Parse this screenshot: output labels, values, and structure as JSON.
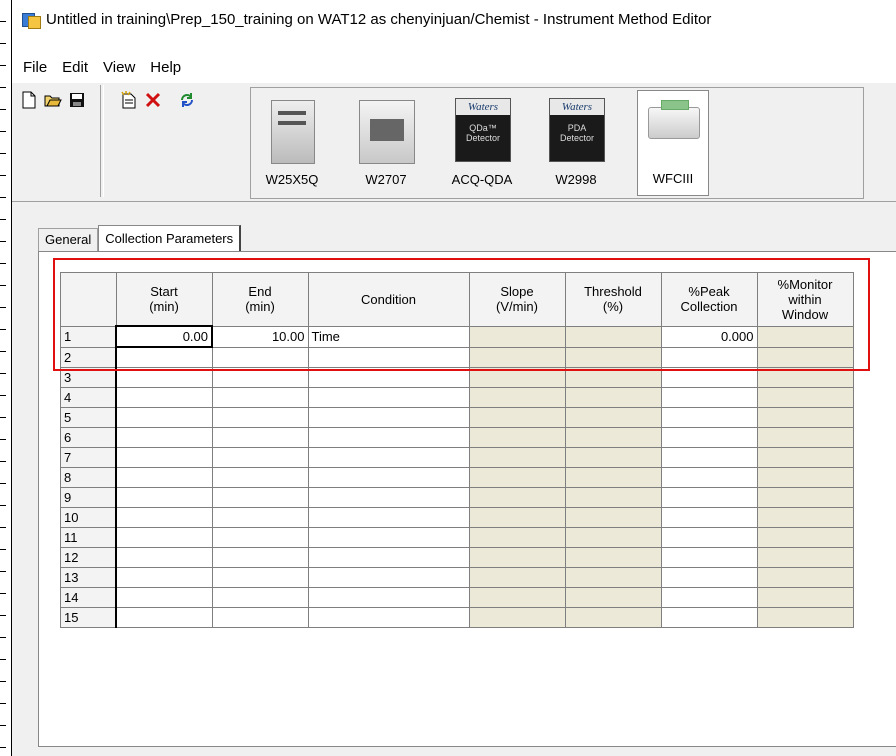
{
  "window": {
    "title": "Untitled in training\\Prep_150_training on WAT12 as chenyinjuan/Chemist - Instrument Method Editor"
  },
  "menu": [
    "File",
    "Edit",
    "View",
    "Help"
  ],
  "toolbar": {
    "buttons": [
      "new-file-icon",
      "open-folder-icon",
      "save-icon",
      "new-document-icon",
      "delete-icon",
      "refresh-icon"
    ]
  },
  "instruments": [
    {
      "label": "W25X5Q",
      "icon": "sample-manager-icon"
    },
    {
      "label": "W2707",
      "icon": "autosampler-icon"
    },
    {
      "label": "ACQ-QDA",
      "icon": "qda-detector-icon",
      "brand": "Waters",
      "text": "QDa™ Detector"
    },
    {
      "label": "W2998",
      "icon": "pda-detector-icon",
      "brand": "Waters",
      "text": "PDA Detector"
    },
    {
      "label": "WFCIII",
      "icon": "fraction-collector-icon",
      "selected": true
    }
  ],
  "tabs": [
    "General",
    "Collection Parameters"
  ],
  "active_tab": "Collection Parameters",
  "grid": {
    "headers": [
      "",
      "Start\n(min)",
      "End\n(min)",
      "Condition",
      "Slope\n(V/min)",
      "Threshold\n(%)",
      "%Peak\nCollection",
      "%Monitor\nwithin\nWindow"
    ],
    "rows": [
      {
        "n": "1",
        "start": "0.00",
        "end": "10.00",
        "condition": "Time",
        "slope": "",
        "threshold": "",
        "peak": "0.000",
        "monitor": ""
      },
      {
        "n": "2",
        "start": "",
        "end": "",
        "condition": "",
        "slope": "",
        "threshold": "",
        "peak": "",
        "monitor": ""
      },
      {
        "n": "3",
        "start": "",
        "end": "",
        "condition": "",
        "slope": "",
        "threshold": "",
        "peak": "",
        "monitor": ""
      },
      {
        "n": "4",
        "start": "",
        "end": "",
        "condition": "",
        "slope": "",
        "threshold": "",
        "peak": "",
        "monitor": ""
      },
      {
        "n": "5",
        "start": "",
        "end": "",
        "condition": "",
        "slope": "",
        "threshold": "",
        "peak": "",
        "monitor": ""
      },
      {
        "n": "6",
        "start": "",
        "end": "",
        "condition": "",
        "slope": "",
        "threshold": "",
        "peak": "",
        "monitor": ""
      },
      {
        "n": "7",
        "start": "",
        "end": "",
        "condition": "",
        "slope": "",
        "threshold": "",
        "peak": "",
        "monitor": ""
      },
      {
        "n": "8",
        "start": "",
        "end": "",
        "condition": "",
        "slope": "",
        "threshold": "",
        "peak": "",
        "monitor": ""
      },
      {
        "n": "9",
        "start": "",
        "end": "",
        "condition": "",
        "slope": "",
        "threshold": "",
        "peak": "",
        "monitor": ""
      },
      {
        "n": "10",
        "start": "",
        "end": "",
        "condition": "",
        "slope": "",
        "threshold": "",
        "peak": "",
        "monitor": ""
      },
      {
        "n": "11",
        "start": "",
        "end": "",
        "condition": "",
        "slope": "",
        "threshold": "",
        "peak": "",
        "monitor": ""
      },
      {
        "n": "12",
        "start": "",
        "end": "",
        "condition": "",
        "slope": "",
        "threshold": "",
        "peak": "",
        "monitor": ""
      },
      {
        "n": "13",
        "start": "",
        "end": "",
        "condition": "",
        "slope": "",
        "threshold": "",
        "peak": "",
        "monitor": ""
      },
      {
        "n": "14",
        "start": "",
        "end": "",
        "condition": "",
        "slope": "",
        "threshold": "",
        "peak": "",
        "monitor": ""
      },
      {
        "n": "15",
        "start": "",
        "end": "",
        "condition": "",
        "slope": "",
        "threshold": "",
        "peak": "",
        "monitor": ""
      }
    ]
  },
  "colors": {
    "highlight": "#e01010",
    "disabled_cell": "#ece9d8",
    "window_bg": "#f0f0f0"
  }
}
